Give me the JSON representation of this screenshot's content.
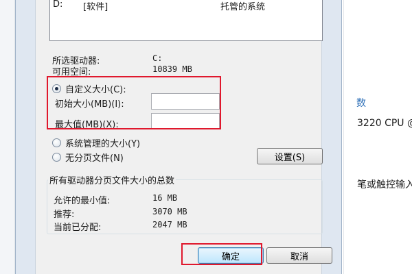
{
  "background_window": {
    "fragments": [
      "数",
      "3220 CPU @",
      "笔或触控输入"
    ]
  },
  "drive_list": {
    "rows": [
      {
        "drive": "D:",
        "label": "[软件]",
        "type": "托管的系统"
      }
    ]
  },
  "selected_drive": {
    "label": "所选驱动器:",
    "value": "C:"
  },
  "free_space": {
    "label": "可用空间:",
    "value": "10839 MB"
  },
  "options": {
    "custom_size": "自定义大小(C):",
    "initial_size_label": "初始大小(MB)(I):",
    "initial_size_value": "",
    "max_size_label": "最大值(MB)(X):",
    "max_size_value": "",
    "system_managed": "系统管理的大小(Y)",
    "no_paging": "无分页文件(N)",
    "set_button": "设置(S)"
  },
  "totals": {
    "title": "所有驱动器分页文件大小的总数",
    "min_label": "允许的最小值:",
    "min_value": "16 MB",
    "recommended_label": "推荐:",
    "recommended_value": "3070 MB",
    "allocated_label": "当前已分配:",
    "allocated_value": "2047 MB"
  },
  "footer": {
    "ok": "确定",
    "cancel": "取消"
  },
  "colors": {
    "highlight": "#e0182d"
  }
}
